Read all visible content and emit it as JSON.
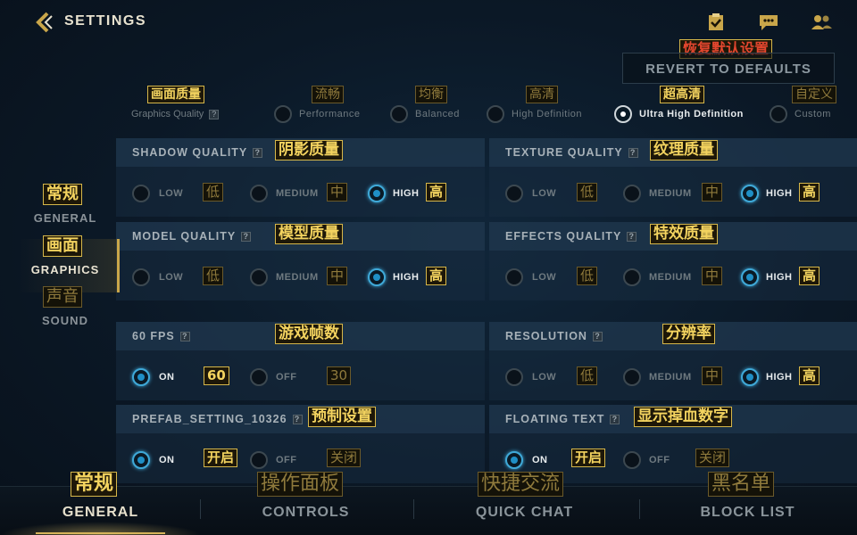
{
  "header": {
    "title": "SETTINGS",
    "revert_label": "REVERT TO DEFAULTS",
    "revert_cn": "恢复默认设置",
    "icons": [
      "back-chevron-icon",
      "clipboard-check-icon",
      "chat-bubble-icon",
      "friends-icon"
    ]
  },
  "graphics_quality": {
    "label": "Graphics Quality",
    "label_cn": "画面质量",
    "help": "?",
    "options": [
      {
        "label": "Performance",
        "cn": "流畅",
        "selected": false
      },
      {
        "label": "Balanced",
        "cn": "均衡",
        "selected": false
      },
      {
        "label": "High Definition",
        "cn": "高清",
        "selected": false
      },
      {
        "label": "Ultra High Definition",
        "cn": "超高清",
        "selected": true
      },
      {
        "label": "Custom",
        "cn": "自定义",
        "selected": false
      }
    ]
  },
  "levels": {
    "low": "LOW",
    "low_cn": "低",
    "medium": "MEDIUM",
    "medium_cn": "中",
    "high": "HIGH",
    "high_cn": "高",
    "on": "ON",
    "on_cn": "开启",
    "off": "OFF",
    "off_cn": "关闭"
  },
  "settings": {
    "shadow": {
      "title": "SHADOW QUALITY",
      "cn": "阴影质量",
      "selected": "HIGH"
    },
    "texture": {
      "title": "TEXTURE QUALITY",
      "cn": "纹理质量",
      "selected": "HIGH"
    },
    "model": {
      "title": "MODEL QUALITY",
      "cn": "模型质量",
      "selected": "HIGH"
    },
    "effects": {
      "title": "EFFECTS QUALITY",
      "cn": "特效质量",
      "selected": "HIGH"
    },
    "fps": {
      "title": "60 FPS",
      "cn": "游戏帧数",
      "on_cn": "60",
      "off_cn": "30",
      "selected": "ON"
    },
    "resolution": {
      "title": "RESOLUTION",
      "cn": "分辨率",
      "selected": "HIGH"
    },
    "prefab": {
      "title": "PREFAB_SETTING_10326",
      "cn": "预制设置",
      "selected": "ON"
    },
    "floating": {
      "title": "FLOATING TEXT",
      "cn": "显示掉血数字",
      "selected": "ON"
    }
  },
  "sidebar": {
    "items": [
      {
        "label": "GENERAL",
        "cn": "常规",
        "selected": false
      },
      {
        "label": "GRAPHICS",
        "cn": "画面",
        "selected": true
      },
      {
        "label": "SOUND",
        "cn": "声音",
        "selected": false
      }
    ]
  },
  "tabs": [
    {
      "label": "GENERAL",
      "cn": "常规",
      "selected": true
    },
    {
      "label": "CONTROLS",
      "cn": "操作面板",
      "selected": false
    },
    {
      "label": "QUICK CHAT",
      "cn": "快捷交流",
      "selected": false
    },
    {
      "label": "BLOCK LIST",
      "cn": "黑名单",
      "selected": false
    }
  ],
  "colors": {
    "accent_gold": "#d6b45a",
    "selected_blue": "#3fa9d8",
    "cn_label": "#f3d35f",
    "revert_cn": "#e2462e"
  }
}
